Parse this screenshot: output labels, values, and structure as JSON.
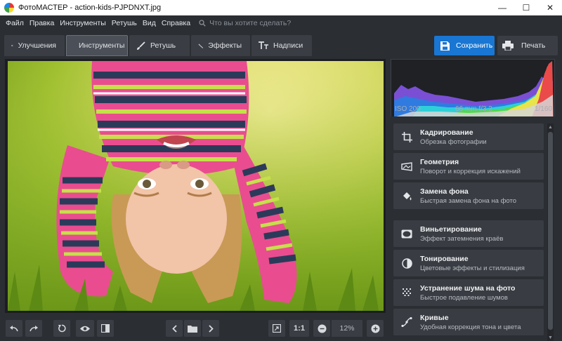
{
  "window": {
    "title": "ФотоМАСТЕР - action-kids-PJPDNXT.jpg",
    "minimize": "—",
    "maximize": "☐",
    "close": "✕"
  },
  "menu": {
    "items": [
      "Файл",
      "Правка",
      "Инструменты",
      "Ретушь",
      "Вид",
      "Справка"
    ],
    "search_placeholder": "Что вы хотите сделать?"
  },
  "tabs": [
    {
      "label": "Улучшения",
      "icon": "sliders-icon",
      "active": false
    },
    {
      "label": "Инструменты",
      "icon": "crop-icon",
      "active": true
    },
    {
      "label": "Ретушь",
      "icon": "brush-icon",
      "active": false
    },
    {
      "label": "Эффекты",
      "icon": "magic-wand-icon",
      "active": false
    },
    {
      "label": "Надписи",
      "icon": "text-icon",
      "active": false
    }
  ],
  "actions": {
    "save_label": "Сохранить",
    "print_label": "Печать"
  },
  "bottombar": {
    "one_to_one": "1:1",
    "zoom": "12%"
  },
  "photo_info": {
    "iso": "ISO 200",
    "lens": "66 mm f/3.2",
    "shutter": "1/160"
  },
  "tools": [
    {
      "title": "Кадрирование",
      "subtitle": "Обрезка фотографии",
      "icon": "crop-icon"
    },
    {
      "title": "Геометрия",
      "subtitle": "Поворот и коррекция искажений",
      "icon": "geometry-icon"
    },
    {
      "title": "Замена фона",
      "subtitle": "Быстрая замена фона на фото",
      "icon": "bucket-icon"
    },
    {
      "title": "Виньетирование",
      "subtitle": "Эффект затемнения краёв",
      "icon": "vignette-icon"
    },
    {
      "title": "Тонирование",
      "subtitle": "Цветовые эффекты и стилизация",
      "icon": "toning-icon"
    },
    {
      "title": "Устранение шума на фото",
      "subtitle": "Быстрое подавление шумов",
      "icon": "noise-icon"
    },
    {
      "title": "Кривые",
      "subtitle": "Удобная коррекция тона и цвета",
      "icon": "curves-icon"
    }
  ],
  "colors": {
    "accent": "#1976d2",
    "background": "#2b2e33",
    "panel": "#393d43"
  }
}
